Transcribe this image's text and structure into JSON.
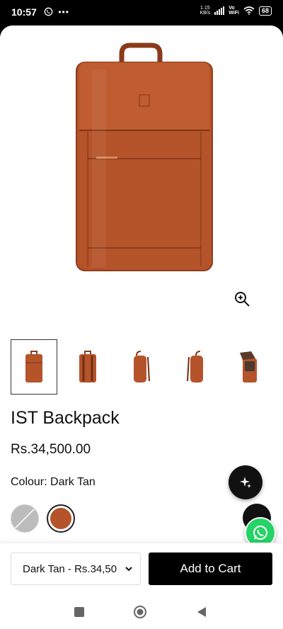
{
  "status_bar": {
    "time": "10:57",
    "network_speed_value": "1.15",
    "network_speed_unit": "KB/s",
    "vowifi_top": "Vo",
    "vowifi_bottom": "WiFi",
    "battery": "68"
  },
  "product": {
    "title": "IST Backpack",
    "price": "Rs.34,500.00",
    "colour_label": "Colour: Dark Tan",
    "swatches": [
      "grey-unavailable",
      "dark-tan-selected"
    ],
    "thumbnail_count": 5
  },
  "purchase_bar": {
    "variant_text": "Dark Tan - Rs.34,50",
    "add_to_cart_label": "Add to Cart"
  },
  "colors": {
    "leather": "#b5532a",
    "accent_black": "#000000",
    "whatsapp": "#25d366"
  },
  "icons": [
    "whatsapp-icon",
    "more-icon",
    "zoom-in-icon",
    "sparkle-icon",
    "chevron-down-icon",
    "square-nav-icon",
    "home-circle-icon",
    "back-triangle-icon"
  ]
}
